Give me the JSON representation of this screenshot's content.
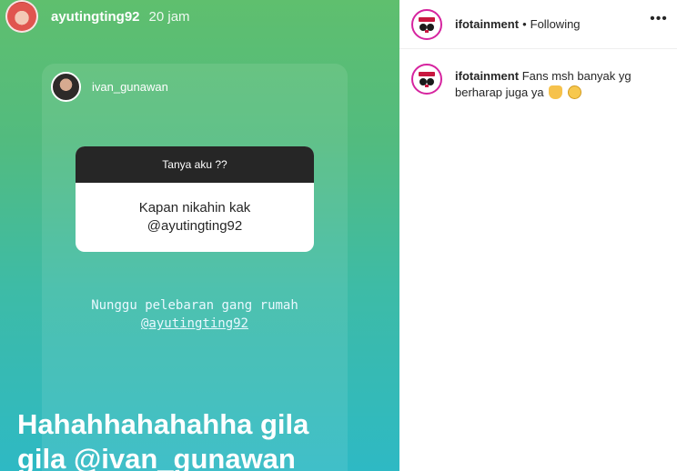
{
  "story": {
    "username": "ayutingting92",
    "time": "20 jam",
    "repost": {
      "username": "ivan_gunawan",
      "question_title": "Tanya aku ??",
      "question_line1": "Kapan nikahin kak",
      "question_line2": "@ayutingting92"
    },
    "reply_line1": "Nunggu pelebaran gang rumah",
    "reply_mention": "@ayutingting92",
    "big_text_line1": "Hahahhahahahha gila",
    "big_text_line2": "gila @ivan_gunawan"
  },
  "post": {
    "username": "ifotainment",
    "separator": "•",
    "follow_status": "Following",
    "more_label": "•••",
    "comment": {
      "username": "ifotainment",
      "text": "Fans msh banyak yg berharap juga ya",
      "emoji_1": "folded-hands",
      "emoji_2": "grinning-sweat"
    }
  },
  "colors": {
    "story_gradient_top": "#5fbf6e",
    "story_gradient_bottom": "#2eb9c4",
    "question_header": "#262626",
    "avatar_ring": "#d6249f"
  }
}
